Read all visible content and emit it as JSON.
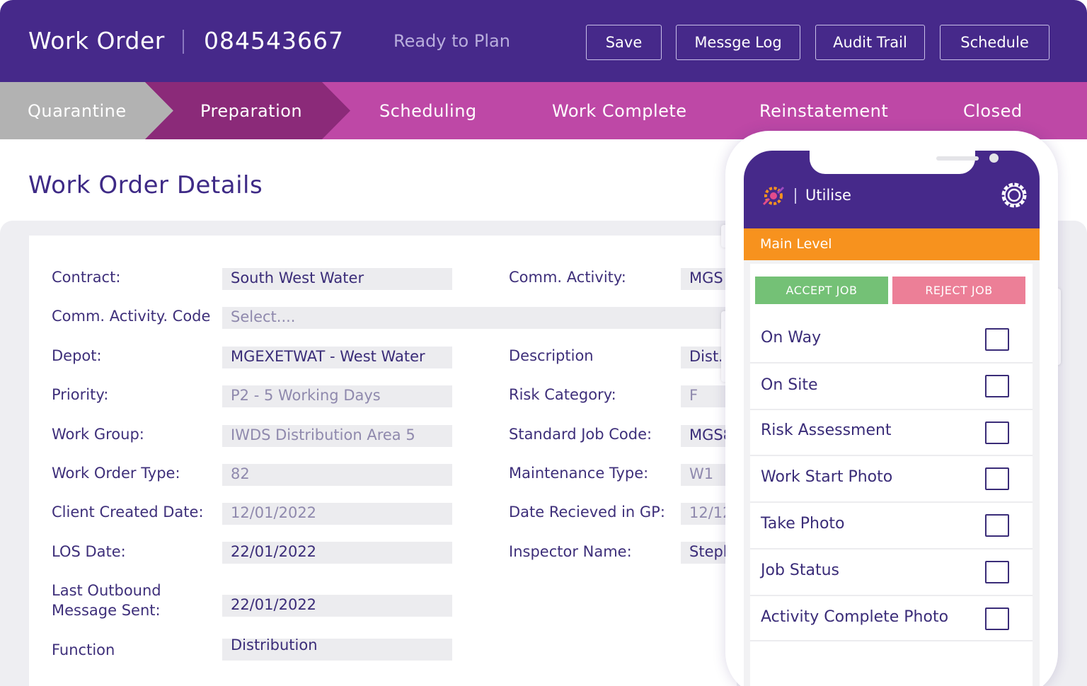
{
  "header": {
    "title": "Work Order",
    "number": "084543667",
    "status": "Ready to Plan",
    "buttons": [
      "Save",
      "Messge Log",
      "Audit Trail",
      "Schedule"
    ]
  },
  "stages": {
    "items": [
      "Quarantine",
      "Preparation",
      "Scheduling",
      "Work Complete",
      "Reinstatement",
      "Closed"
    ],
    "active": "Preparation",
    "colors": {
      "done": "#b2b2b2",
      "active": "#8b2a79",
      "pending": "#be48a6"
    }
  },
  "details": {
    "title": "Work Order Details",
    "left": [
      {
        "label": "Contract:",
        "value": "South West Water"
      },
      {
        "label": "Comm. Activity. Code",
        "value": "Select...."
      },
      {
        "label": "Depot:",
        "value": "MGEXETWAT - West Water"
      },
      {
        "label": "Priority:",
        "value": "P2 - 5 Working Days"
      },
      {
        "label": "Work Group:",
        "value": "IWDS Distribution Area 5"
      },
      {
        "label": "Work Order Type:",
        "value": "82"
      },
      {
        "label": "Client Created Date:",
        "value": "12/01/2022"
      },
      {
        "label": "LOS Date:",
        "value": "22/01/2022"
      },
      {
        "label": "Last Outbound Message Sent:",
        "value": "22/01/2022"
      },
      {
        "label": "Function",
        "value": "Distribution"
      }
    ],
    "right": [
      {
        "label": "Comm. Activity:",
        "value": "MGS"
      },
      {
        "label": "Description",
        "value": "Dist."
      },
      {
        "label": "Risk Category:",
        "value": "F"
      },
      {
        "label": "Standard Job Code:",
        "value": "MGS8"
      },
      {
        "label": "Maintenance Type:",
        "value": "W1"
      },
      {
        "label": "Date Recieved in GP:",
        "value": "12/12"
      },
      {
        "label": "Inspector Name:",
        "value": "Steph"
      }
    ]
  },
  "phone": {
    "app_name": "Utilise",
    "level": "Main Level",
    "accept_label": "ACCEPT JOB",
    "reject_label": "REJECT JOB",
    "checklist": [
      "On Way",
      "On Site",
      "Risk Assessment",
      "Work Start Photo",
      "Take Photo",
      "Job Status",
      "Activity Complete Photo"
    ],
    "colors": {
      "header": "#46298a",
      "level": "#f7921e",
      "accept": "#74c176",
      "reject": "#ec7f97"
    }
  }
}
